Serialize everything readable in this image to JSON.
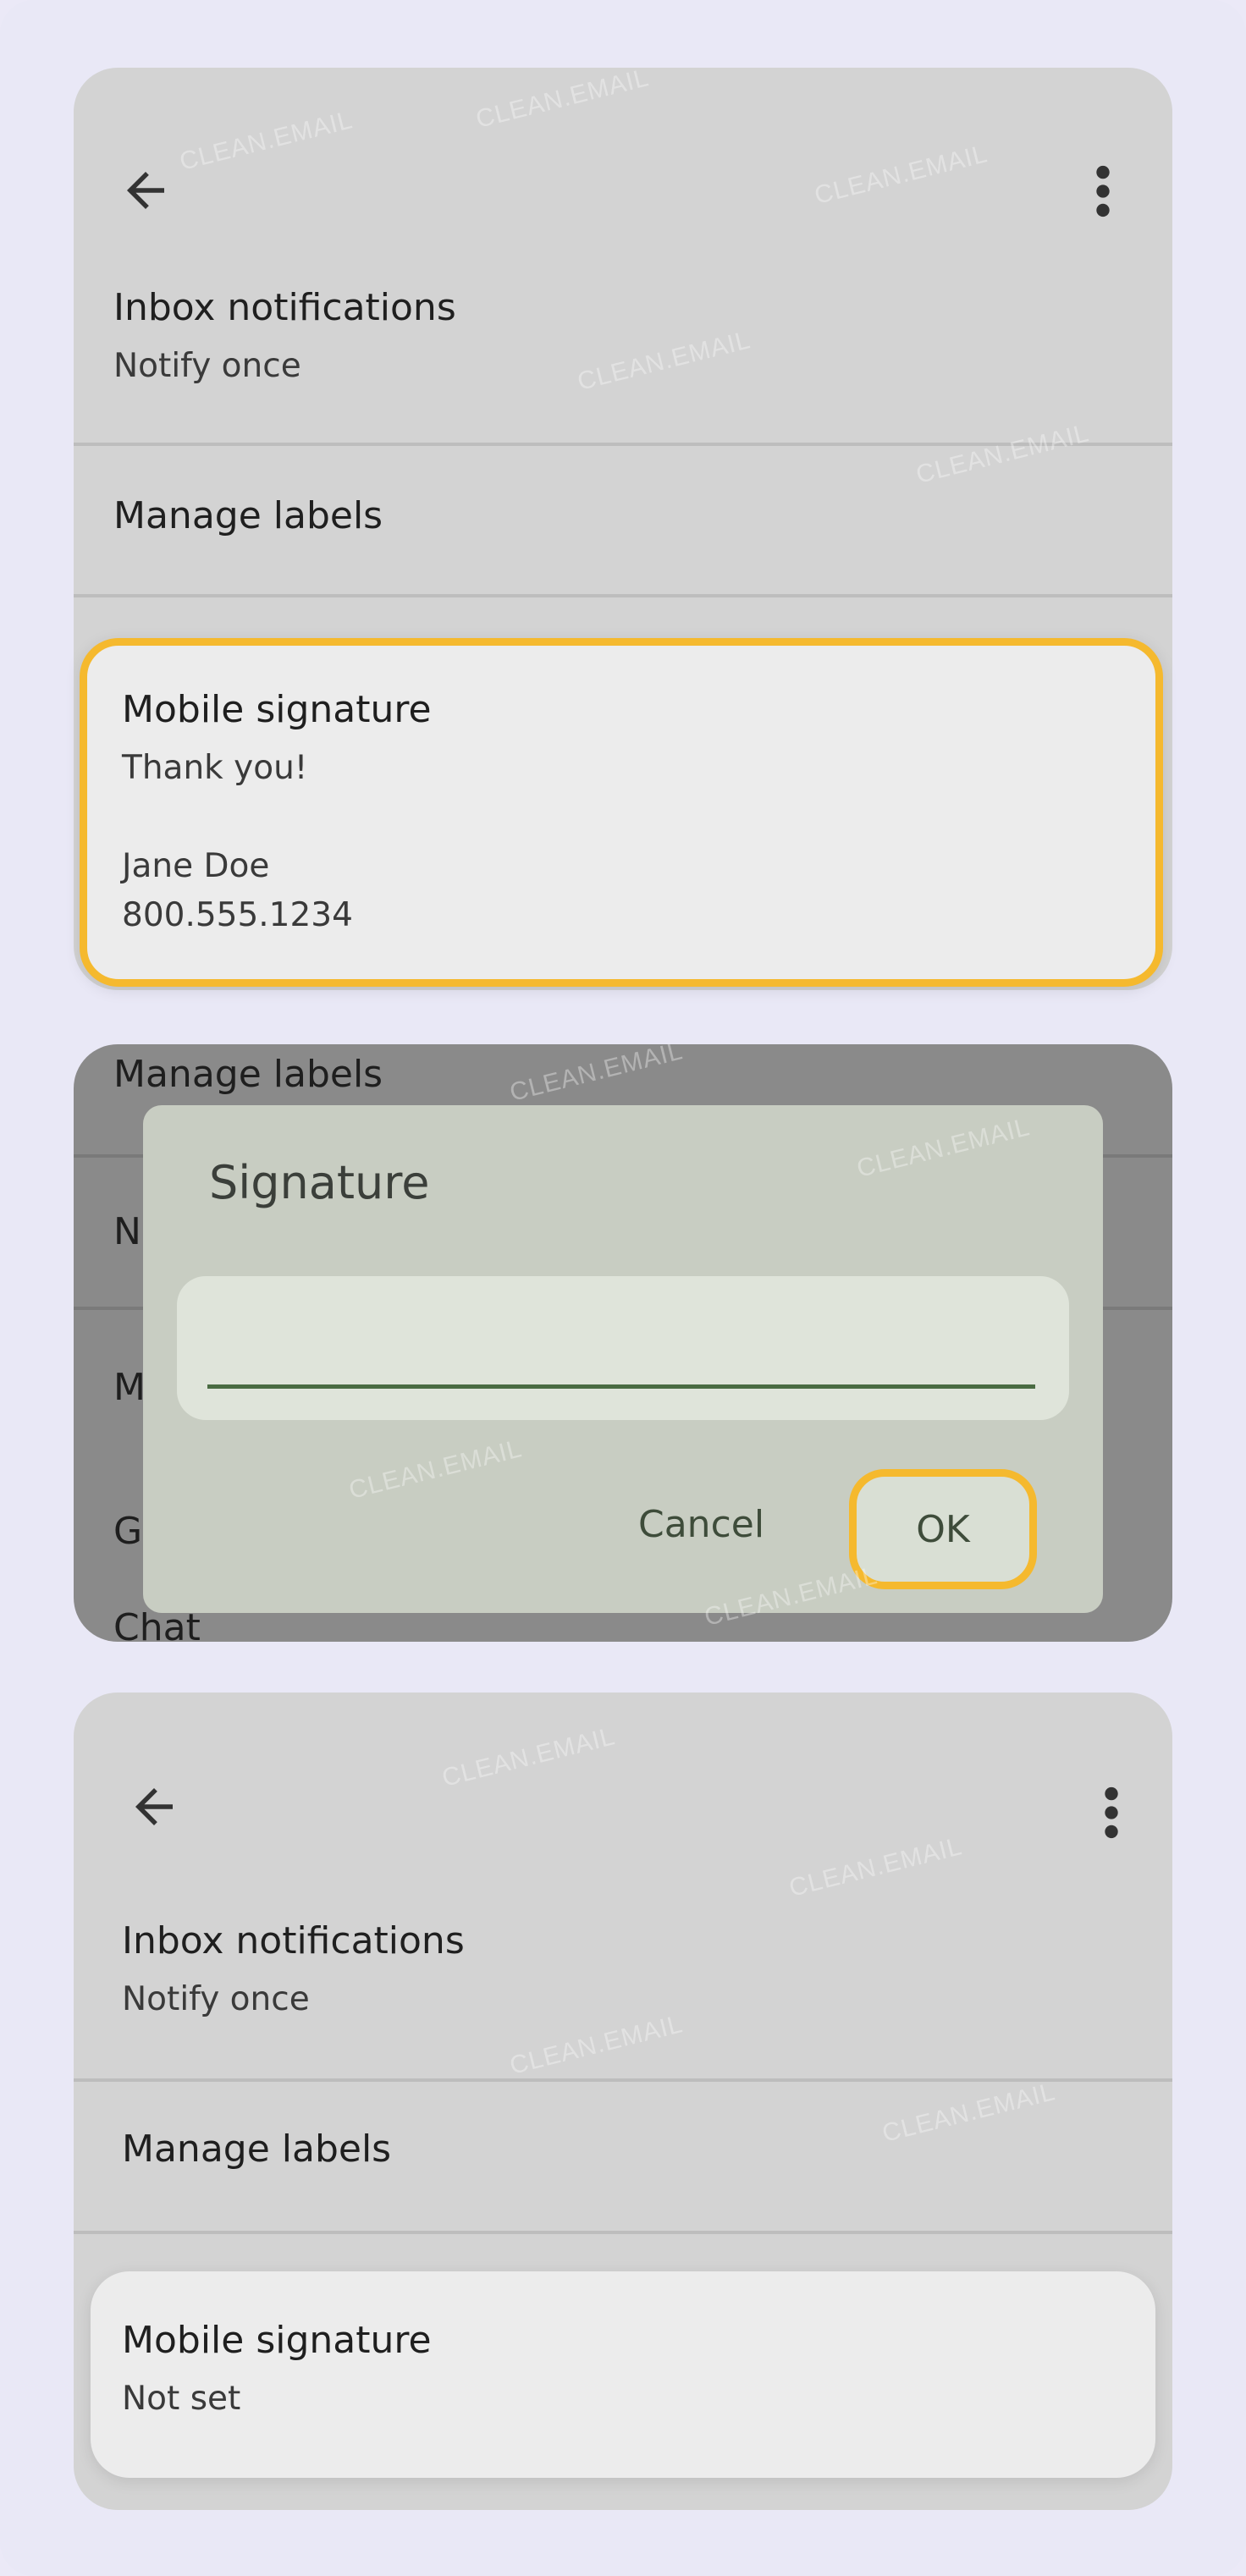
{
  "watermark": "CLEAN.EMAIL",
  "screen1": {
    "inbox_notifications": {
      "title": "Inbox notifications",
      "value": "Notify once"
    },
    "manage_labels": "Manage labels",
    "mobile_signature": {
      "title": "Mobile signature",
      "line1": "Thank you!",
      "line2": "Jane Doe",
      "line3": "800.555.1234"
    }
  },
  "screen2": {
    "background_rows": [
      "Manage labels",
      "N",
      "M",
      "G",
      "Chat"
    ],
    "dialog": {
      "title": "Signature",
      "input_value": "",
      "cancel_label": "Cancel",
      "ok_label": "OK"
    }
  },
  "screen3": {
    "inbox_notifications": {
      "title": "Inbox notifications",
      "value": "Notify once"
    },
    "manage_labels": "Manage labels",
    "mobile_signature": {
      "title": "Mobile signature",
      "value": "Not set"
    }
  },
  "colors": {
    "highlight": "#f5b92e",
    "background": "#e9e8f6",
    "panel": "#d3d3d3"
  }
}
